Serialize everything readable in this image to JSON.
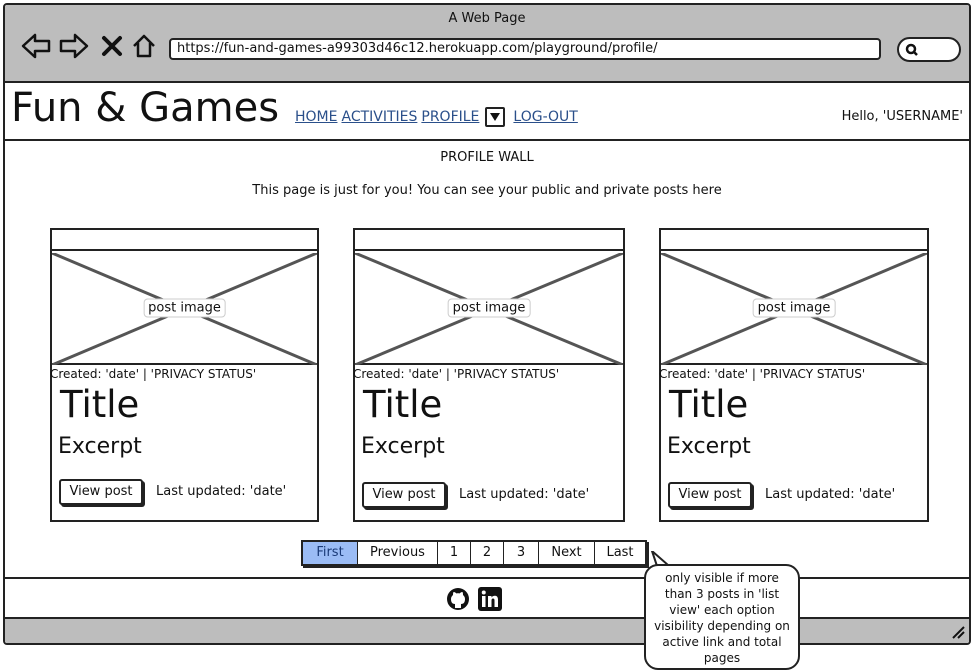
{
  "window": {
    "title": "A Web Page",
    "url": "https://fun-and-games-a99303d46c12.herokuapp.com/playground/profile/"
  },
  "header": {
    "brand": "Fun & Games",
    "nav": {
      "home": "HOME",
      "activities": "ACTIVITIES",
      "profile": "PROFILE",
      "logout": "LOG-OUT"
    },
    "greeting": "Hello, 'USERNAME'"
  },
  "wall": {
    "title": "PROFILE WALL",
    "subtitle": "This page is just for you! You can see your public and private posts here"
  },
  "posts": [
    {
      "image_label": "post image",
      "meta": "Created: 'date' | 'PRIVACY STATUS'",
      "title": "Title",
      "excerpt": "Excerpt",
      "button": "View post",
      "updated": "Last updated: 'date'"
    },
    {
      "image_label": "post image",
      "meta": "Created: 'date' | 'PRIVACY STATUS'",
      "title": "Title",
      "excerpt": "Excerpt",
      "button": "View post",
      "updated": "Last updated: 'date'"
    },
    {
      "image_label": "post image",
      "meta": "Created: 'date' | 'PRIVACY STATUS'",
      "title": "Title",
      "excerpt": "Excerpt",
      "button": "View post",
      "updated": "Last updated: 'date'"
    }
  ],
  "pagination": {
    "first": "First",
    "previous": "Previous",
    "p1": "1",
    "p2": "2",
    "p3": "3",
    "next": "Next",
    "last": "Last",
    "active": "First"
  },
  "note": "only visible if more than 3 posts in 'list view' each option visibility depending on active link and total pages",
  "icons": {
    "social": [
      "github-icon",
      "linkedin-icon"
    ]
  },
  "colors": {
    "link": "#2a4f8a",
    "active_page": "#9bbcf5",
    "chrome": "#bdbdbd"
  }
}
